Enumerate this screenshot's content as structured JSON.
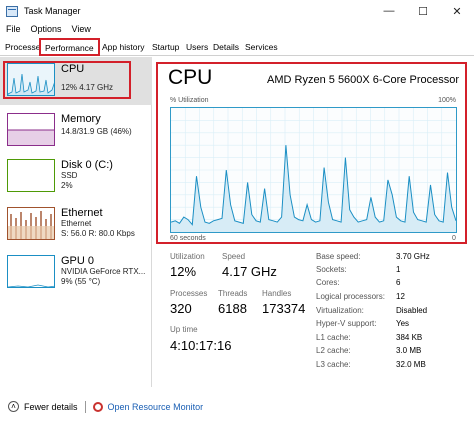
{
  "window": {
    "title": "Task Manager",
    "min_glyph": "—",
    "max_glyph": "☐",
    "close_glyph": "✕"
  },
  "menu": [
    "File",
    "Options",
    "View"
  ],
  "tabs": [
    "Processe",
    "Performance",
    "App history",
    "Startup",
    "Users",
    "Details",
    "Services"
  ],
  "resources": [
    {
      "name": "CPU",
      "line1": "12%  4.17 GHz",
      "line2": "",
      "color": "#1b8fc4"
    },
    {
      "name": "Memory",
      "line1": "14.8/31.9 GB (46%)",
      "line2": "",
      "color": "#8b2e8b"
    },
    {
      "name": "Disk 0 (C:)",
      "line1": "SSD",
      "line2": "2%",
      "color": "#4e9a06"
    },
    {
      "name": "Ethernet",
      "line1": "Ethernet",
      "line2": "S: 56.0  R: 80.0 Kbps",
      "color": "#a0522d"
    },
    {
      "name": "GPU 0",
      "line1": "NVIDIA GeForce RTX...",
      "line2": "9% (55 °C)",
      "color": "#1b8fc4"
    }
  ],
  "main": {
    "title": "CPU",
    "model": "AMD Ryzen 5 5600X 6-Core Processor",
    "y_label": "% Utilization",
    "y_max_label": "100%",
    "x_left_label": "60 seconds",
    "x_right_label": "0"
  },
  "stats": {
    "utilization_label": "Utilization",
    "utilization": "12%",
    "speed_label": "Speed",
    "speed": "4.17 GHz",
    "processes_label": "Processes",
    "processes": "320",
    "threads_label": "Threads",
    "threads": "6188",
    "handles_label": "Handles",
    "handles": "173374",
    "uptime_label": "Up time",
    "uptime": "4:10:17:16"
  },
  "specs": [
    {
      "label": "Base speed:",
      "value": "3.70 GHz"
    },
    {
      "label": "Sockets:",
      "value": "1"
    },
    {
      "label": "Cores:",
      "value": "6"
    },
    {
      "label": "Logical processors:",
      "value": "12"
    },
    {
      "label": "Virtualization:",
      "value": "Disabled"
    },
    {
      "label": "Hyper-V support:",
      "value": "Yes"
    },
    {
      "label": "L1 cache:",
      "value": "384 KB"
    },
    {
      "label": "L2 cache:",
      "value": "3.0 MB"
    },
    {
      "label": "L3 cache:",
      "value": "32.0 MB"
    }
  ],
  "footer": {
    "fewer_details": "Fewer details",
    "open_monitor": "Open Resource Monitor"
  },
  "cpu_history_pct": [
    8,
    9,
    7,
    12,
    10,
    6,
    45,
    20,
    8,
    7,
    9,
    10,
    11,
    50,
    22,
    9,
    8,
    7,
    40,
    14,
    9,
    8,
    35,
    10,
    9,
    8,
    12,
    70,
    30,
    12,
    10,
    9,
    22,
    10,
    8,
    9,
    52,
    24,
    10,
    9,
    8,
    60,
    18,
    12,
    8,
    9,
    10,
    28,
    12,
    8,
    9,
    42,
    30,
    12,
    9,
    8,
    45,
    16,
    10,
    9,
    8,
    38,
    14,
    9,
    8,
    48,
    20,
    9
  ]
}
